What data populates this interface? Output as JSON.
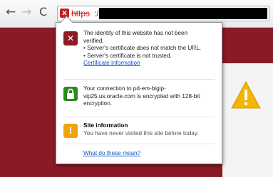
{
  "browser": {
    "nav": {
      "back": "←",
      "forward": "→",
      "reload": "C"
    },
    "address": {
      "warning_icon": "x",
      "scheme": "https",
      "separator": ":/"
    }
  },
  "page": {
    "colors": {
      "background": "#8b1a27",
      "warning": "#f4b400"
    }
  },
  "popup": {
    "identity": {
      "icon": "broken-certificate-icon",
      "lines": [
        "The identity of this website has not been",
        "verified.",
        "• Server's certificate does not match the URL.",
        "• Server's certificate is not trusted."
      ],
      "link": "Certificate information"
    },
    "connection": {
      "icon": "padlock-icon",
      "lines": [
        "Your connection to pd-em-bigip-",
        "vip25.us.oracle.com is encrypted with 128-bit",
        "encryption."
      ]
    },
    "site_info": {
      "icon": "exclamation-icon",
      "title": "Site information",
      "text": "You have never visited this site before today."
    },
    "help_link": "What do these mean?"
  }
}
